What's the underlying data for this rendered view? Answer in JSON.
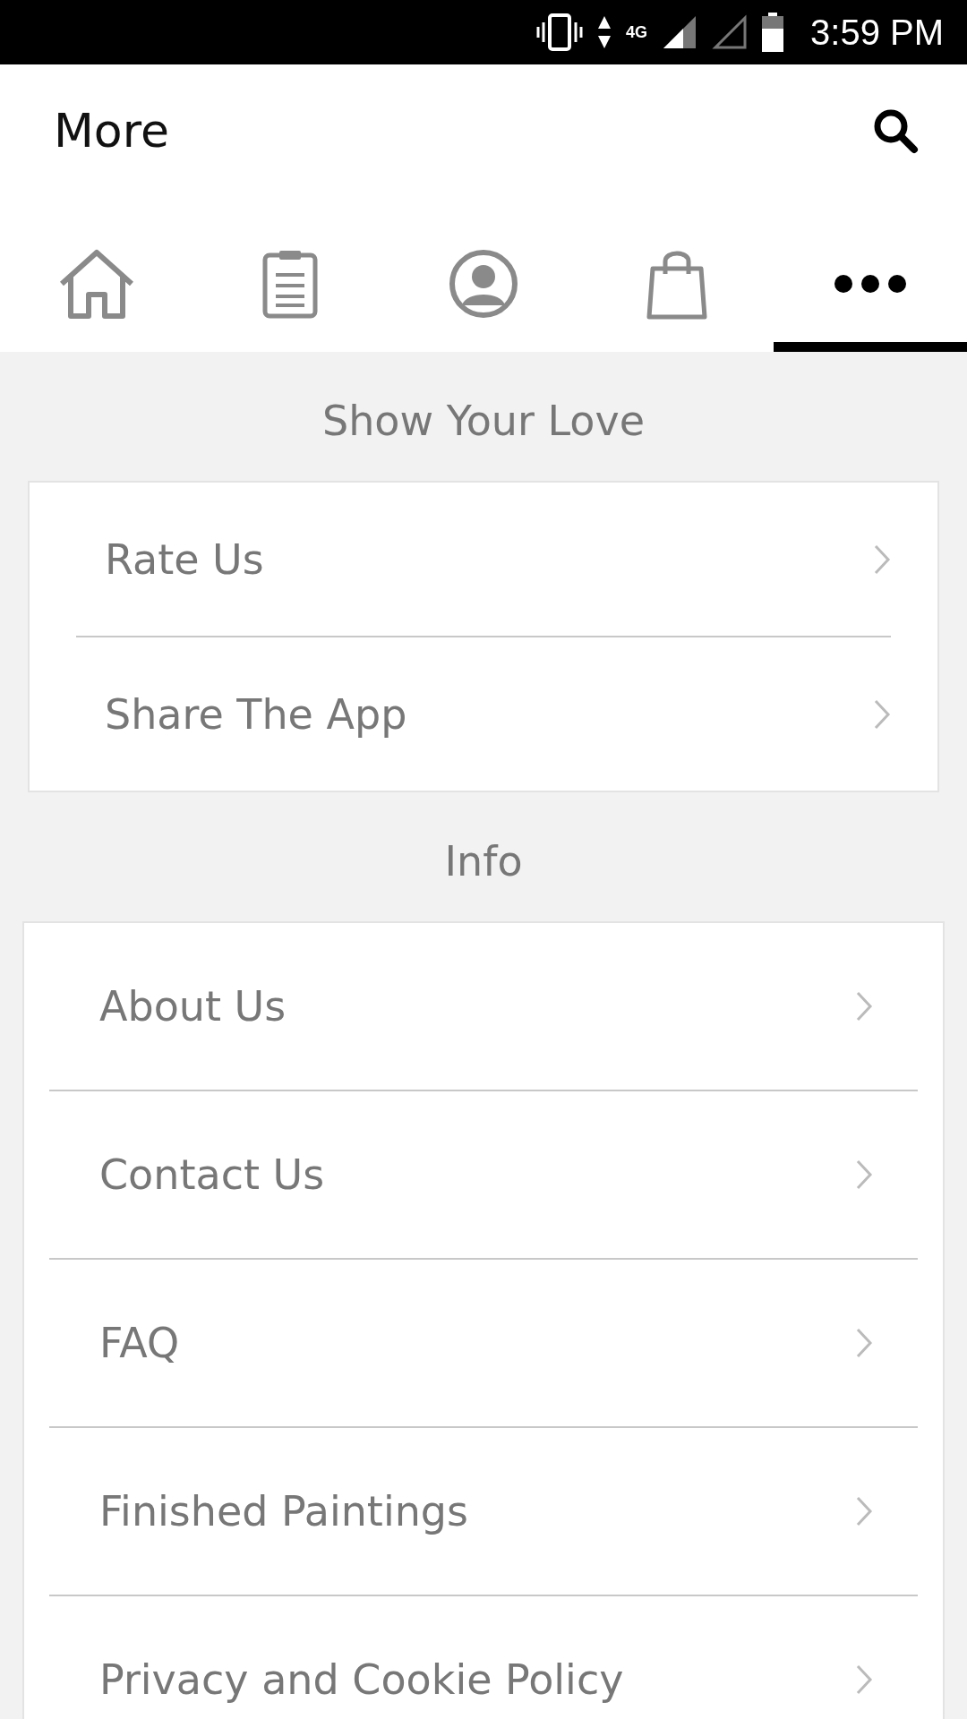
{
  "status_bar": {
    "network": "4G",
    "time": "3:59 PM"
  },
  "header": {
    "title": "More"
  },
  "tabs": [
    {
      "kind": "home",
      "selected": false
    },
    {
      "kind": "clipboard",
      "selected": false
    },
    {
      "kind": "profile",
      "selected": false
    },
    {
      "kind": "bag",
      "selected": false
    },
    {
      "kind": "more",
      "selected": true
    }
  ],
  "sections": [
    {
      "title": "Show Your Love",
      "kind": "compact",
      "items": [
        "Rate Us",
        "Share The App"
      ]
    },
    {
      "title": "Info",
      "kind": "wide",
      "items": [
        "About Us",
        "Contact Us",
        "FAQ",
        "Finished Paintings",
        "Privacy and Cookie Policy"
      ]
    }
  ]
}
